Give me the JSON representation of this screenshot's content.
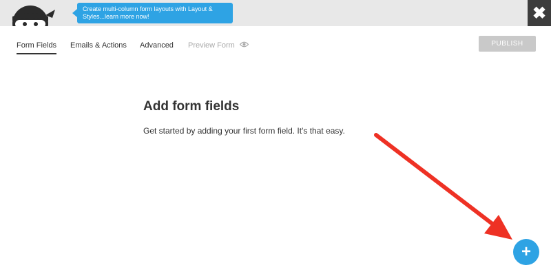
{
  "header": {
    "notice_text": "Create multi-column form layouts with Layout & Styles...learn more now!",
    "close_icon": "close-icon"
  },
  "tabs": [
    {
      "label": "Form Fields",
      "active": true
    },
    {
      "label": "Emails & Actions",
      "active": false
    },
    {
      "label": "Advanced",
      "active": false
    },
    {
      "label": "Preview Form",
      "disabled": true
    }
  ],
  "toolbar": {
    "publish_label": "PUBLISH"
  },
  "main": {
    "title": "Add form fields",
    "description": "Get started by adding your first form field. It's that easy."
  },
  "fab": {
    "icon": "plus-icon",
    "glyph": "+"
  },
  "colors": {
    "accent": "#2ea3e4",
    "arrow": "#ee3124",
    "topbar": "#e8e8e8"
  }
}
